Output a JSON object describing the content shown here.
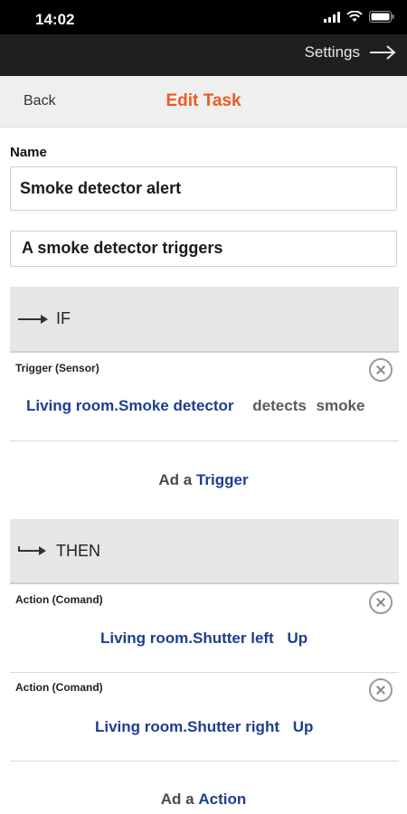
{
  "status": {
    "time": "14:02"
  },
  "topbar": {
    "settings_label": "Settings"
  },
  "nav": {
    "back_label": "Back",
    "title": "Edit Task"
  },
  "form": {
    "name_label": "Name",
    "name_value": "Smoke detector alert",
    "description_value": "A smoke detector triggers"
  },
  "if_section": {
    "header": "IF",
    "triggers": [
      {
        "label": "Trigger (Sensor)",
        "device": "Living room.Smoke detector",
        "verb": "detects",
        "object": "smoke"
      }
    ],
    "add_prefix": "Ad a",
    "add_link": "Trigger"
  },
  "then_section": {
    "header": "THEN",
    "actions": [
      {
        "label": "Action (Comand)",
        "device": "Living room.Shutter left",
        "command": "Up"
      },
      {
        "label": "Action (Comand)",
        "device": "Living room.Shutter right",
        "command": "Up"
      }
    ],
    "add_prefix": "Ad a",
    "add_link": "Action"
  },
  "colors": {
    "accent": "#ee5a1f",
    "link": "#1e3d8f",
    "topbar": "#1f1f1f"
  }
}
